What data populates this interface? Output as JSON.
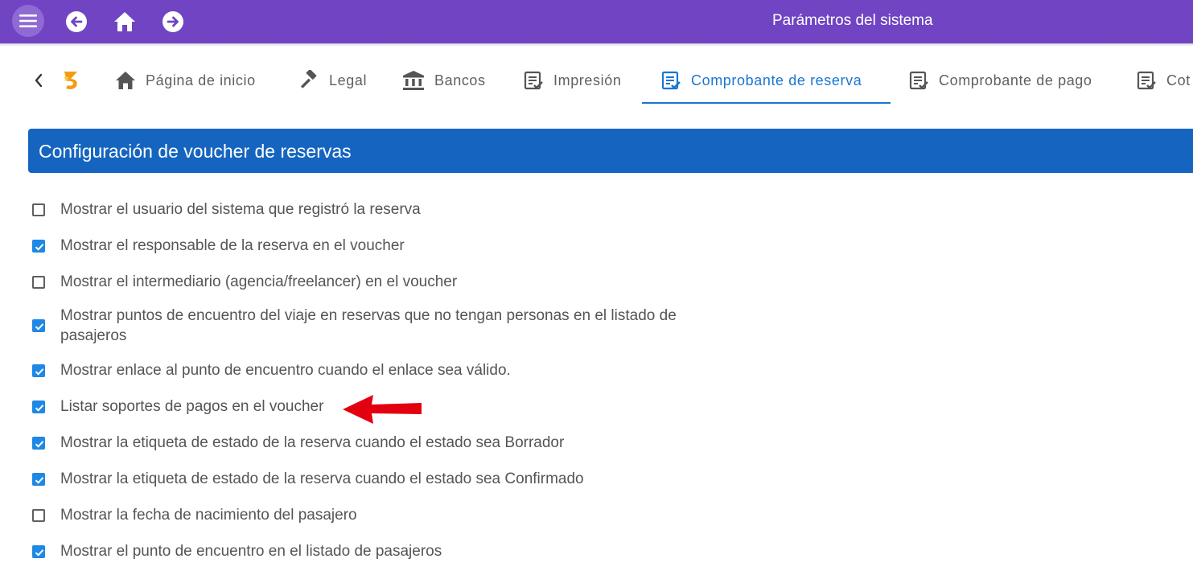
{
  "app": {
    "title": "Parámetros del sistema"
  },
  "topbar": {
    "icons": [
      "menu-icon",
      "back-arrow-icon",
      "home-icon",
      "forward-arrow-icon"
    ],
    "color": "#7044c2"
  },
  "tabs": [
    {
      "label": "Página de inicio",
      "icon": "home-icon",
      "active": false
    },
    {
      "label": "Legal",
      "icon": "gavel-icon",
      "active": false
    },
    {
      "label": "Bancos",
      "icon": "bank-icon",
      "active": false
    },
    {
      "label": "Impresión",
      "icon": "document-check-icon",
      "active": false
    },
    {
      "label": "Comprobante de reserva",
      "icon": "document-check-icon",
      "active": true
    },
    {
      "label": "Comprobante de pago",
      "icon": "document-check-icon",
      "active": false
    },
    {
      "label": "Cot",
      "icon": "document-check-icon",
      "active": false
    }
  ],
  "section": {
    "title": "Configuración de voucher de reservas",
    "color": "#1565c0"
  },
  "options": [
    {
      "label": "Mostrar el usuario del sistema que registró la reserva",
      "checked": false
    },
    {
      "label": "Mostrar el responsable de la reserva en el voucher",
      "checked": true
    },
    {
      "label": "Mostrar el intermediario (agencia/freelancer) en el voucher",
      "checked": false
    },
    {
      "label": "Mostrar puntos de encuentro del viaje en reservas que no tengan personas en el listado de pasajeros",
      "checked": true
    },
    {
      "label": "Mostrar enlace al punto de encuentro cuando el enlace sea válido.",
      "checked": true
    },
    {
      "label": "Listar soportes de pagos en el voucher",
      "checked": true
    },
    {
      "label": "Mostrar la etiqueta de estado de la reserva cuando el estado sea Borrador",
      "checked": true
    },
    {
      "label": "Mostrar la etiqueta de estado de la reserva cuando el estado sea Confirmado",
      "checked": true
    },
    {
      "label": "Mostrar la fecha de nacimiento del pasajero",
      "checked": false
    },
    {
      "label": "Mostrar el punto de encuentro en el listado de pasajeros",
      "checked": true
    }
  ],
  "annotation": {
    "icon": "red-arrow-icon",
    "color": "#e3000f"
  }
}
